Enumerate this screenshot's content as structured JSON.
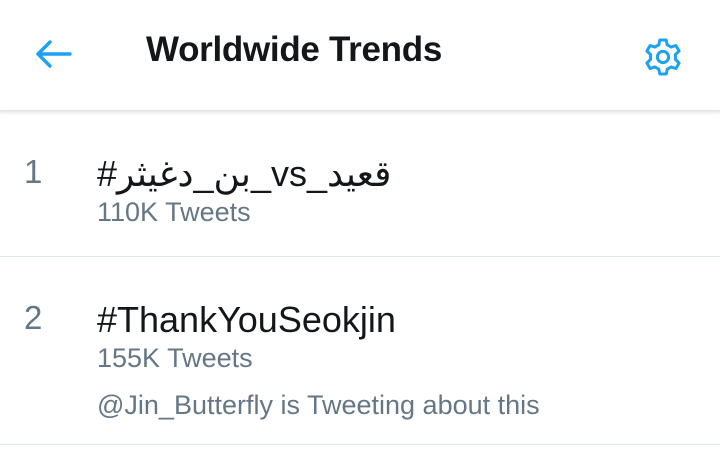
{
  "header": {
    "title": "Worldwide Trends",
    "back_icon": "arrow-left-icon",
    "settings_icon": "gear-icon",
    "accent_color": "#1da1f2"
  },
  "trends": [
    {
      "rank": "1",
      "name": "#بن_دغيثر_vs_قعيد",
      "tweet_count": "110K Tweets"
    },
    {
      "rank": "2",
      "name": "#ThankYouSeokjin",
      "tweet_count": "155K Tweets",
      "context": "@Jin_Butterfly is Tweeting about this"
    }
  ]
}
